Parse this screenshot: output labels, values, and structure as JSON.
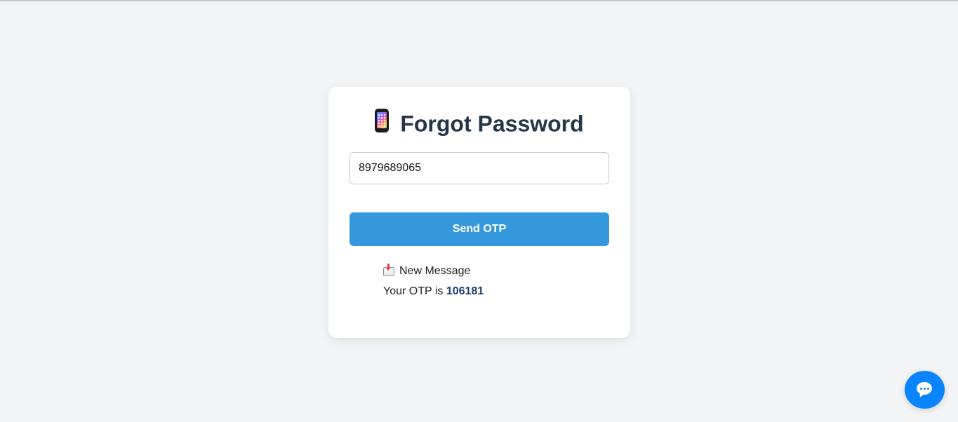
{
  "page": {
    "title_icon": "mobile-phone-icon",
    "title": "Forgot Password"
  },
  "form": {
    "phone_value": "8979689065",
    "send_label": "Send OTP"
  },
  "message": {
    "icon": "inbox-tray-icon",
    "heading": "New Message",
    "otp_prefix": "Your OTP is",
    "otp_code": "106181"
  },
  "chat": {
    "icon": "chat-bubble-icon"
  },
  "colors": {
    "background": "#f3f4f6",
    "primary_button": "#3698dc",
    "title_text": "#253649",
    "chat_button": "#0a84ff",
    "otp_code": "#1d3f6e"
  }
}
